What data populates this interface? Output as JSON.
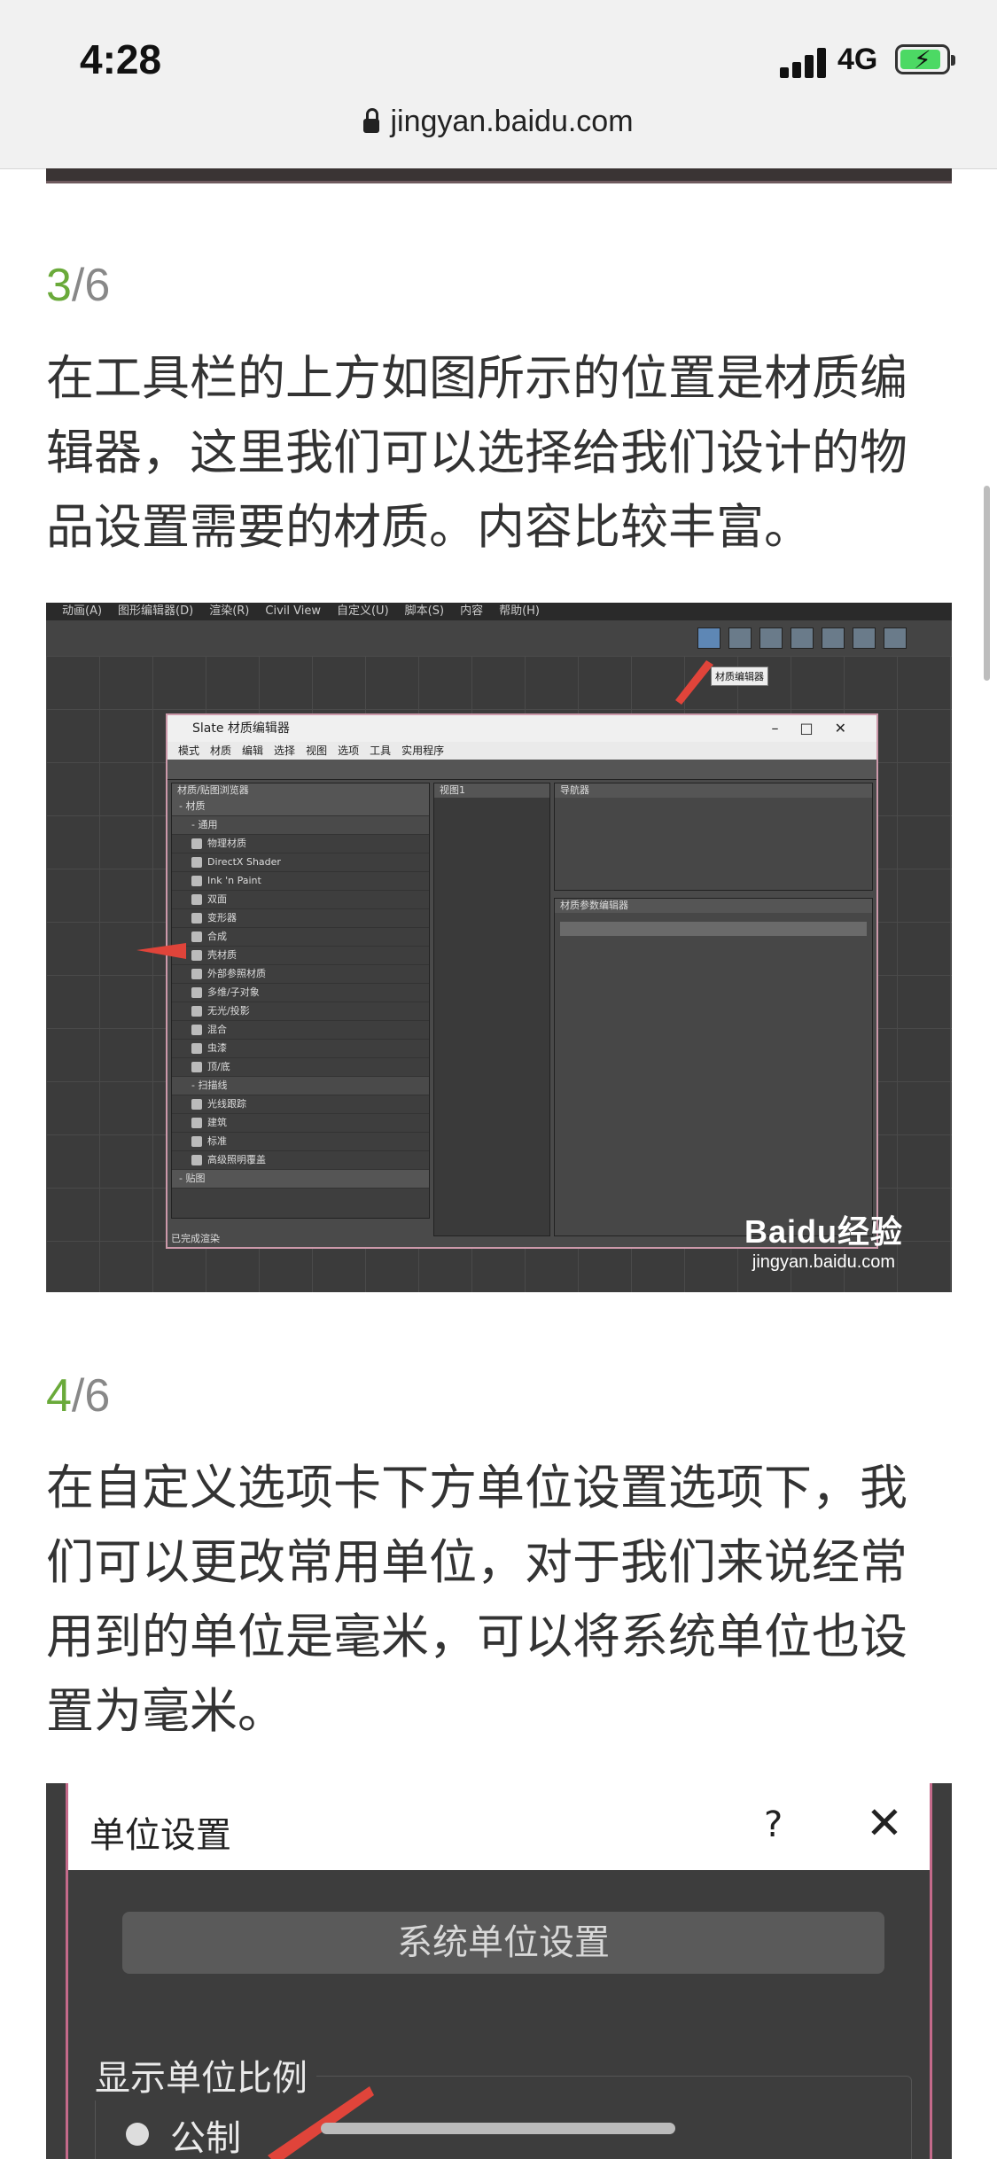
{
  "status_bar": {
    "time": "4:28",
    "network": "4G"
  },
  "browser": {
    "url": "jingyan.baidu.com"
  },
  "steps": [
    {
      "current": "3",
      "total": "/6",
      "text": "在工具栏的上方如图所示的位置是材质编辑器，这里我们可以选择给我们设计的物品设置需要的材质。内容比较丰富。",
      "image": {
        "menubar": [
          "动画(A)",
          "图形编辑器(D)",
          "渲染(R)",
          "Civil View",
          "自定义(U)",
          "脚本(S)",
          "内容",
          "帮助(H)"
        ],
        "tooltip": "材质编辑器",
        "window_title": "Slate 材质编辑器",
        "window_menu": [
          "模式",
          "材质",
          "编辑",
          "选择",
          "视图",
          "选项",
          "工具",
          "实用程序"
        ],
        "browser_title": "材质/贴图浏览器",
        "browser_rows": [
          {
            "label": "- 材质",
            "kind": "hdr"
          },
          {
            "label": "- 通用",
            "kind": "sub"
          },
          {
            "label": "物理材质",
            "kind": "item"
          },
          {
            "label": "DirectX Shader",
            "kind": "item"
          },
          {
            "label": "Ink 'n Paint",
            "kind": "item"
          },
          {
            "label": "双面",
            "kind": "item"
          },
          {
            "label": "变形器",
            "kind": "item"
          },
          {
            "label": "合成",
            "kind": "item"
          },
          {
            "label": "壳材质",
            "kind": "item"
          },
          {
            "label": "外部参照材质",
            "kind": "item"
          },
          {
            "label": "多维/子对象",
            "kind": "item"
          },
          {
            "label": "无光/投影",
            "kind": "item"
          },
          {
            "label": "混合",
            "kind": "item"
          },
          {
            "label": "虫漆",
            "kind": "item"
          },
          {
            "label": "顶/底",
            "kind": "item"
          },
          {
            "label": "- 扫描线",
            "kind": "sub"
          },
          {
            "label": "光线跟踪",
            "kind": "item"
          },
          {
            "label": "建筑",
            "kind": "item"
          },
          {
            "label": "标准",
            "kind": "item"
          },
          {
            "label": "高级照明覆盖",
            "kind": "item"
          },
          {
            "label": "- 贴图",
            "kind": "hdr"
          }
        ],
        "view_label": "视图1",
        "navigator_label": "导航器",
        "params_label": "材质参数编辑器",
        "status_text": "已完成渲染",
        "watermark_brand": "Baidu经验",
        "watermark_url": "jingyan.baidu.com"
      }
    },
    {
      "current": "4",
      "total": "/6",
      "text": "在自定义选项卡下方单位设置选项下，我们可以更改常用单位，对于我们来说经常用到的单位是毫米，可以将系统单位也设置为毫米。",
      "image": {
        "dialog_title": "单位设置",
        "help": "?",
        "close": "✕",
        "system_button": "系统单位设置",
        "group_label": "显示单位比例",
        "radio_label": "公制"
      }
    }
  ]
}
